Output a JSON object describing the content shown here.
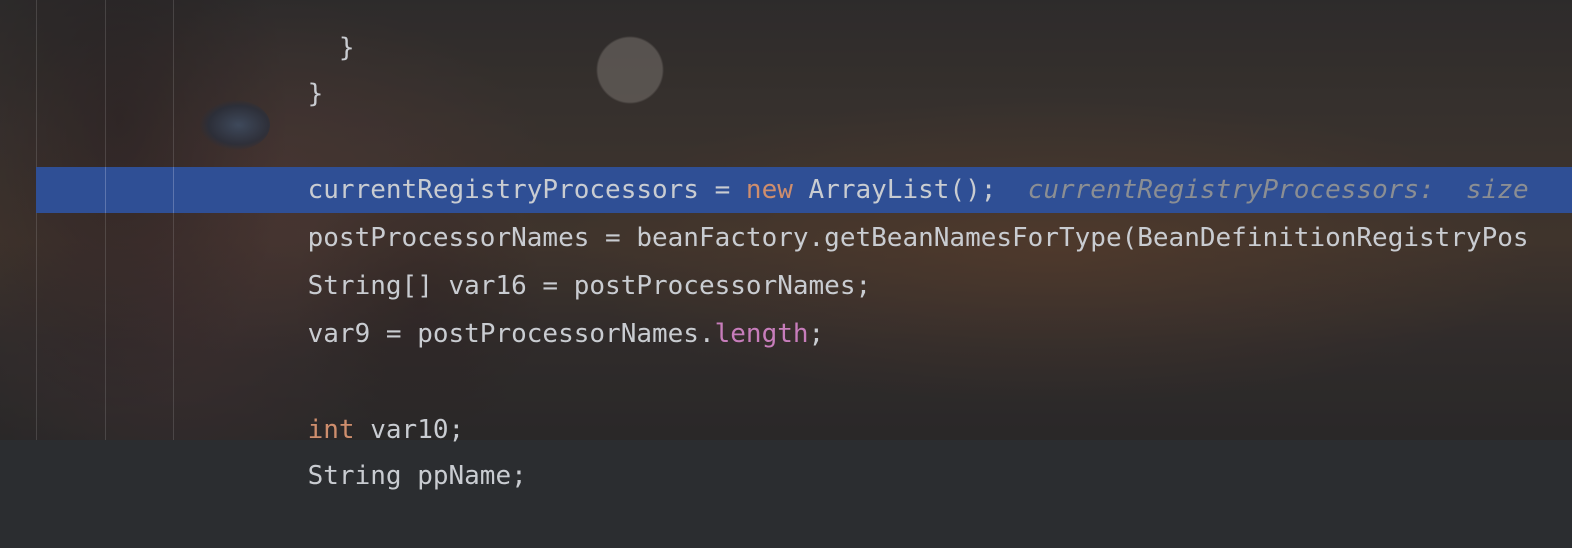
{
  "editor": {
    "lines": [
      {
        "id": "brace_inner",
        "parts": [
          {
            "t": "  }",
            "k": "punct"
          }
        ]
      },
      {
        "id": "brace_outer",
        "parts": [
          {
            "t": "}",
            "k": "punct"
          }
        ]
      },
      {
        "id": "registry",
        "parts": [
          {
            "t": "currentRegistryProcessors = ",
            "k": "plain"
          },
          {
            "t": "new",
            "k": "kw"
          },
          {
            "t": " ArrayList();",
            "k": "plain"
          },
          {
            "t": "  currentRegistryProcessors:  size",
            "k": "hint"
          }
        ]
      },
      {
        "id": "names",
        "parts": [
          {
            "t": "postProcessorNames = beanFactory.getBeanNamesForType(BeanDefinitionRegistryPos",
            "k": "plain"
          }
        ]
      },
      {
        "id": "var16",
        "parts": [
          {
            "t": "String[] var16 = postProcessorNames;",
            "k": "plain"
          }
        ]
      },
      {
        "id": "var9",
        "parts": [
          {
            "t": "var9 = postProcessorNames.",
            "k": "plain"
          },
          {
            "t": "length",
            "k": "field"
          },
          {
            "t": ";",
            "k": "plain"
          }
        ]
      },
      {
        "id": "var10",
        "parts": [
          {
            "t": "int",
            "k": "kw"
          },
          {
            "t": " var10;",
            "k": "plain"
          }
        ]
      },
      {
        "id": "ppname",
        "parts": [
          {
            "t": "String ppName;",
            "k": "plain"
          }
        ]
      }
    ],
    "colors": {
      "current_line": "#2f4f95",
      "keyword": "#cf8e6d",
      "field": "#c77dbb",
      "text": "#c9ccd1",
      "hint": "#8b8e93"
    }
  }
}
